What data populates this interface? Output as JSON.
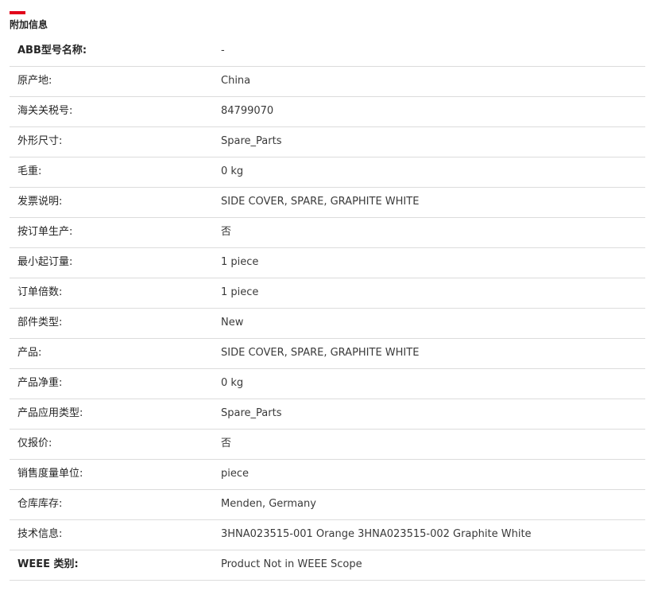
{
  "section": {
    "title": "附加信息",
    "accent_color": "#e2001a"
  },
  "rows": [
    {
      "label": "ABB型号名称:",
      "value": "-"
    },
    {
      "label": "原产地:",
      "value": "China"
    },
    {
      "label": "海关关税号:",
      "value": "84799070"
    },
    {
      "label": "外形尺寸:",
      "value": "Spare_Parts"
    },
    {
      "label": "毛重:",
      "value": "0 kg"
    },
    {
      "label": "发票说明:",
      "value": "SIDE COVER, SPARE, GRAPHITE WHITE"
    },
    {
      "label": "按订单生产:",
      "value": "否"
    },
    {
      "label": "最小起订量:",
      "value": "1 piece"
    },
    {
      "label": "订单倍数:",
      "value": "1 piece"
    },
    {
      "label": "部件类型:",
      "value": "New"
    },
    {
      "label": "产品:",
      "value": "SIDE COVER, SPARE, GRAPHITE WHITE"
    },
    {
      "label": "产品净重:",
      "value": "0 kg"
    },
    {
      "label": "产品应用类型:",
      "value": "Spare_Parts"
    },
    {
      "label": "仅报价:",
      "value": "否"
    },
    {
      "label": "销售度量单位:",
      "value": "piece"
    },
    {
      "label": "仓库库存:",
      "value": "Menden, Germany"
    },
    {
      "label": "技术信息:",
      "value": "3HNA023515-001 Orange 3HNA023515-002 Graphite White"
    },
    {
      "label": "WEEE 类别:",
      "value": "Product Not in WEEE Scope"
    }
  ]
}
